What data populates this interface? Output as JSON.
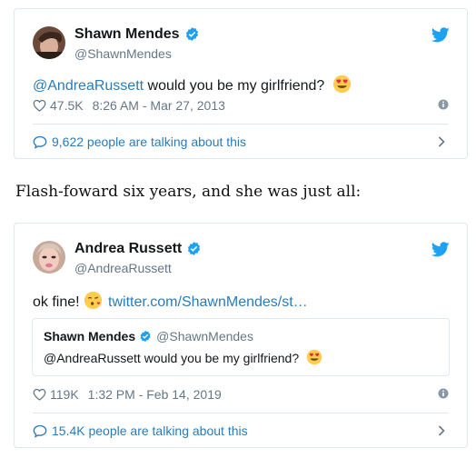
{
  "tweet1": {
    "author": {
      "name": "Shawn Mendes",
      "handle": "@ShawnMendes"
    },
    "text": {
      "mention": "@AndreaRussett",
      "body": " would you be my girlfriend?"
    },
    "emoji": "heart-eyes-emoji",
    "likes": "47.5K",
    "timestamp": "8:26 AM - Mar 27, 2013",
    "talking": "9,622 people are talking about this"
  },
  "caption": "Flash-foward six years, and she was just all:",
  "tweet2": {
    "author": {
      "name": "Andrea Russett",
      "handle": "@AndreaRussett"
    },
    "text": {
      "body": "ok fine! ",
      "link": "twitter.com/ShawnMendes/st…"
    },
    "emoji": "kissing-face-emoji",
    "quoted": {
      "name": "Shawn Mendes",
      "handle": "@ShawnMendes",
      "text": "@AndreaRussett would you be my girlfriend?",
      "emoji": "heart-eyes-emoji"
    },
    "likes": "119K",
    "timestamp": "1:32 PM - Feb 14, 2019",
    "talking": "15.4K people are talking about this"
  },
  "colors": {
    "link": "#2b7bb9",
    "twitter_blue": "#1da1f2",
    "muted": "#657786",
    "border": "#e1e8ed"
  }
}
